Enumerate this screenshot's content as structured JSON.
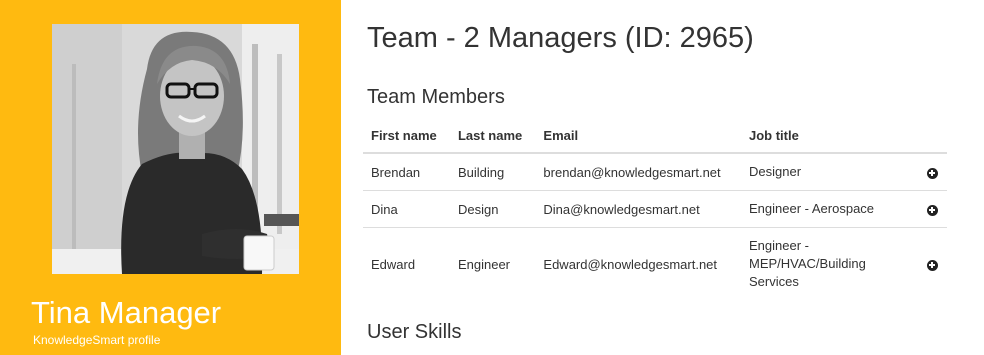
{
  "profile": {
    "name": "Tina Manager",
    "subtitle": "KnowledgeSmart profile",
    "card_color": "#ffba10"
  },
  "team": {
    "title": "Team - 2 Managers (ID: 2965)",
    "members_heading": "Team Members",
    "skills_heading": "User Skills",
    "columns": [
      "First name",
      "Last name",
      "Email",
      "Job title"
    ],
    "rows": [
      {
        "first": "Brendan",
        "last": "Building",
        "email": "brendan@knowledgesmart.net",
        "job": "Designer",
        "action_icon": "plus-circle-icon"
      },
      {
        "first": "Dina",
        "last": "Design",
        "email": "Dina@knowledgesmart.net",
        "job": "Engineer - Aerospace",
        "action_icon": "plus-circle-icon"
      },
      {
        "first": "Edward",
        "last": "Engineer",
        "email": "Edward@knowledgesmart.net",
        "job": "Engineer - MEP/HVAC/Building Services",
        "action_icon": "plus-circle-icon"
      }
    ]
  }
}
